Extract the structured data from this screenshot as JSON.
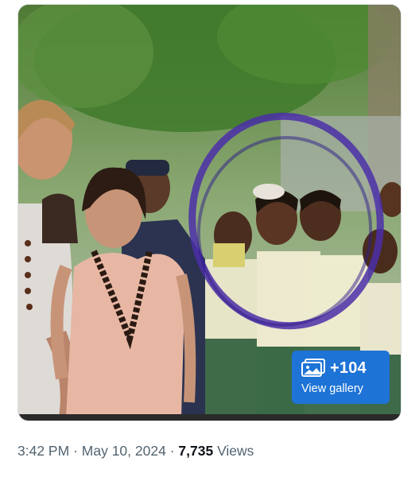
{
  "tweet": {
    "gallery": {
      "count": "+104",
      "label": "View gallery"
    },
    "time": "3:42 PM",
    "separator": "·",
    "date": "May 10, 2024",
    "views_count": "7,735",
    "views_label": "Views"
  },
  "colors": {
    "badge": "#1d73d6",
    "meta_text": "#536471",
    "annotation_circle": "#4b2fa8"
  },
  "icons": {
    "gallery": "gallery-icon"
  }
}
